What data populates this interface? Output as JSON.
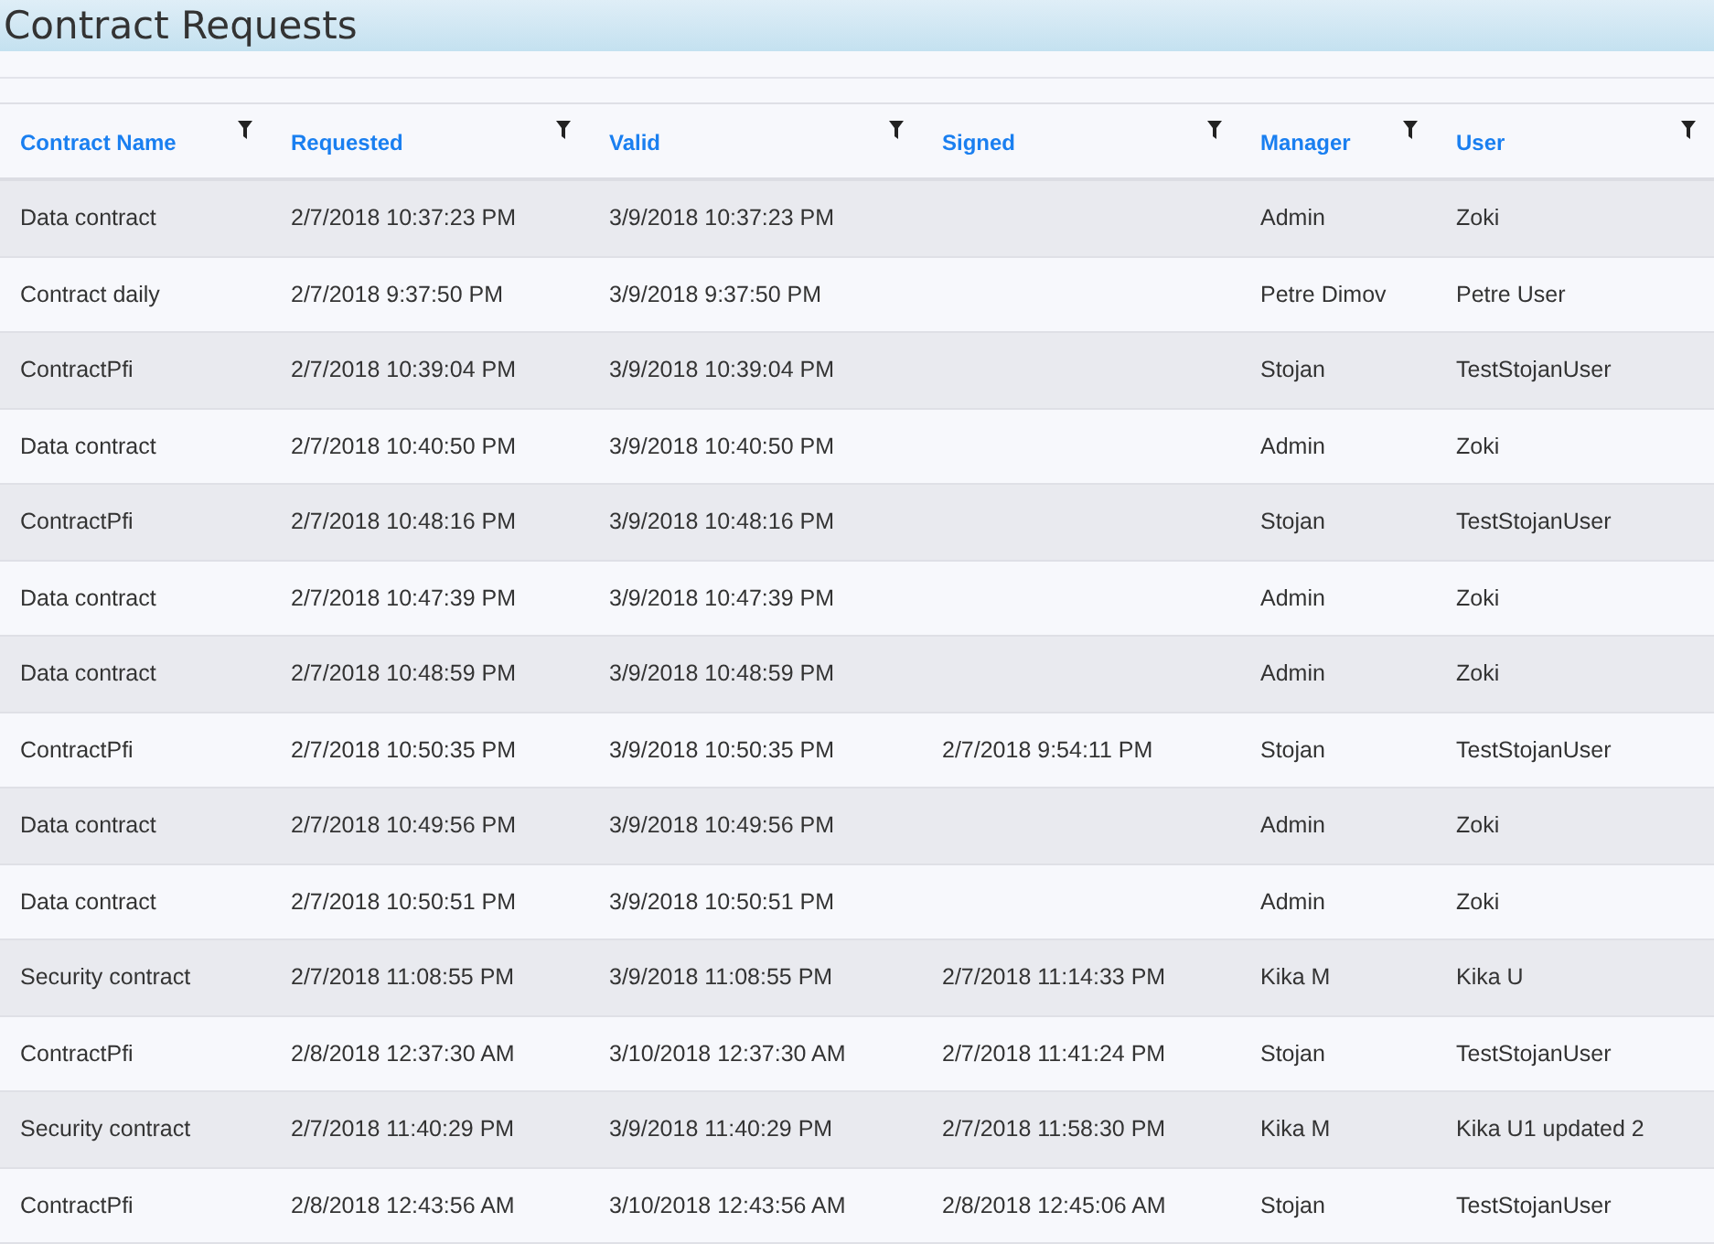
{
  "page_title": "Contract Requests",
  "table": {
    "columns": [
      "Contract Name",
      "Requested",
      "Valid",
      "Signed",
      "Manager",
      "User"
    ],
    "rows": [
      {
        "contract_name": "Data contract",
        "requested": "2/7/2018 10:37:23 PM",
        "valid": "3/9/2018 10:37:23 PM",
        "manager": "Admin",
        "user": "Zoki"
      },
      {
        "contract_name": "Contract daily",
        "requested": "2/7/2018 9:37:50 PM",
        "valid": "3/9/2018 9:37:50 PM",
        "manager": "Petre Dimov",
        "user": "Petre User"
      },
      {
        "contract_name": "ContractPfi",
        "requested": "2/7/2018 10:39:04 PM",
        "valid": "3/9/2018 10:39:04 PM",
        "manager": "Stojan",
        "user": "TestStojanUser"
      },
      {
        "contract_name": "Data contract",
        "requested": "2/7/2018 10:40:50 PM",
        "valid": "3/9/2018 10:40:50 PM",
        "manager": "Admin",
        "user": "Zoki"
      },
      {
        "contract_name": "ContractPfi",
        "requested": "2/7/2018 10:48:16 PM",
        "valid": "3/9/2018 10:48:16 PM",
        "manager": "Stojan",
        "user": "TestStojanUser"
      },
      {
        "contract_name": "Data contract",
        "requested": "2/7/2018 10:47:39 PM",
        "valid": "3/9/2018 10:47:39 PM",
        "manager": "Admin",
        "user": "Zoki"
      },
      {
        "contract_name": "Data contract",
        "requested": "2/7/2018 10:48:59 PM",
        "valid": "3/9/2018 10:48:59 PM",
        "manager": "Admin",
        "user": "Zoki"
      },
      {
        "contract_name": "ContractPfi",
        "requested": "2/7/2018 10:50:35 PM",
        "valid": "3/9/2018 10:50:35 PM",
        "signed": "2/7/2018 9:54:11 PM",
        "manager": "Stojan",
        "user": "TestStojanUser"
      },
      {
        "contract_name": "Data contract",
        "requested": "2/7/2018 10:49:56 PM",
        "valid": "3/9/2018 10:49:56 PM",
        "manager": "Admin",
        "user": "Zoki"
      },
      {
        "contract_name": "Data contract",
        "requested": "2/7/2018 10:50:51 PM",
        "valid": "3/9/2018 10:50:51 PM",
        "manager": "Admin",
        "user": "Zoki"
      },
      {
        "contract_name": "Security contract",
        "requested": "2/7/2018 11:08:55 PM",
        "valid": "3/9/2018 11:08:55 PM",
        "signed": "2/7/2018 11:14:33 PM",
        "manager": "Kika M",
        "user": "Kika U"
      },
      {
        "contract_name": "ContractPfi",
        "requested": "2/8/2018 12:37:30 AM",
        "valid": "3/10/2018 12:37:30 AM",
        "signed": "2/7/2018 11:41:24 PM",
        "manager": "Stojan",
        "user": "TestStojanUser"
      },
      {
        "contract_name": "Security contract",
        "requested": "2/7/2018 11:40:29 PM",
        "valid": "3/9/2018 11:40:29 PM",
        "signed": "2/7/2018 11:58:30 PM",
        "manager": "Kika M",
        "user": "Kika U1 updated 2"
      },
      {
        "contract_name": "ContractPfi",
        "requested": "2/8/2018 12:43:56 AM",
        "valid": "3/10/2018 12:43:56 AM",
        "signed": "2/8/2018 12:45:06 AM",
        "manager": "Stojan",
        "user": "TestStojanUser"
      }
    ]
  }
}
